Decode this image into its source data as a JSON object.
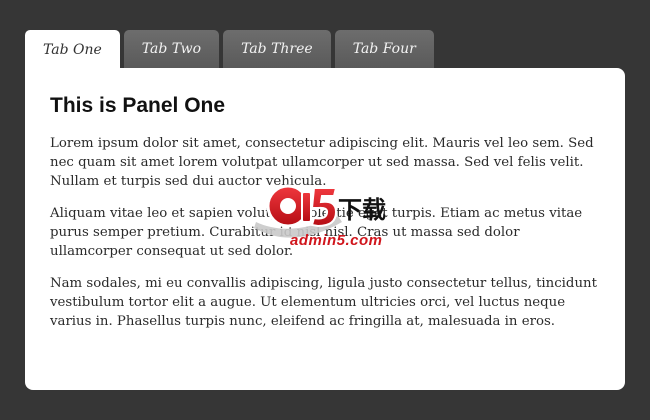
{
  "tabs": [
    {
      "label": "Tab One",
      "active": true
    },
    {
      "label": "Tab Two",
      "active": false
    },
    {
      "label": "Tab Three",
      "active": false
    },
    {
      "label": "Tab Four",
      "active": false
    }
  ],
  "panel": {
    "title": "This is Panel One",
    "paragraphs": [
      "Lorem ipsum dolor sit amet, consectetur adipiscing elit. Mauris vel leo sem. Sed nec quam sit amet lorem volutpat ullamcorper ut sed massa. Sed vel felis velit. Nullam et turpis sed dui auctor vehicula.",
      "Aliquam vitae leo et sapien volutpat molestie eget turpis. Etiam ac metus vitae purus semper pretium. Curabitur id nisl nisl. Cras ut massa sed dolor ullamcorper consequat ut sed dolor.",
      "Nam sodales, mi eu convallis adipiscing, ligula justo consectetur tellus, tincidunt vestibulum tortor elit a augue. Ut elementum ultricies orci, vel luctus neque varius in. Phasellus turpis nunc, eleifend ac fringilla at, malesuada in eros."
    ]
  },
  "watermark": {
    "logo_text": "admin5.com",
    "logo_cn": "下载"
  },
  "colors": {
    "background": "#363636",
    "panel": "#ffffff",
    "tab_inactive": "#5f5f5f",
    "watermark_red": "#d0151c"
  }
}
